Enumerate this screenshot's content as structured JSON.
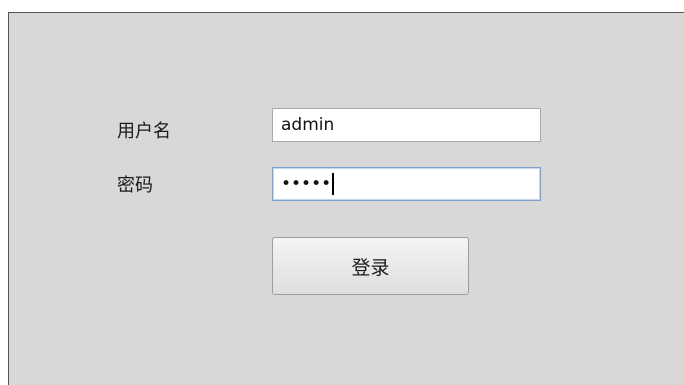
{
  "login_form": {
    "username_label": "用户名",
    "password_label": "密码",
    "username_value": "admin",
    "password_mask": "•••••",
    "login_button_label": "登录"
  },
  "colors": {
    "window_background": "#d8d8d8",
    "field_background": "#ffffff",
    "focus_border": "#7da2ce"
  }
}
